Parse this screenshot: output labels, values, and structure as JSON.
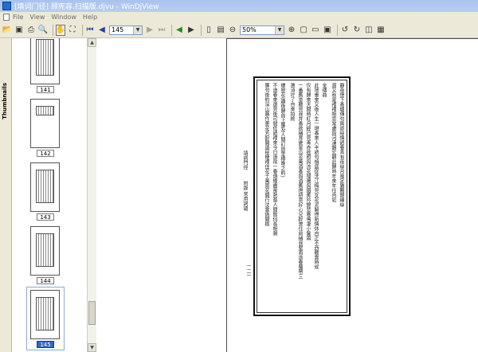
{
  "window": {
    "title": "[填词门径] 顾宪容.扫描版.djvu - WinDjView"
  },
  "menu": {
    "items": [
      "File",
      "View",
      "Window",
      "Help"
    ]
  },
  "toolbar": {
    "page_value": "145",
    "zoom_value": "50%"
  },
  "sidebar": {
    "tab_label": "Thumbnails"
  },
  "thumbnails": [
    {
      "label": "141"
    },
    {
      "label": "142"
    },
    {
      "label": "143"
    },
    {
      "label": "144"
    },
    {
      "label": "145",
      "selected": true
    }
  ],
  "page": {
    "binding_title": "填詞門徑",
    "binding_sub": "附錄 常用詞譜",
    "page_number": "一二一",
    "columns": [
      "靜夜燈下香爐傳句輿遊絲情語春宵有夜絲月風定猶飄錦練絲",
      "渡又秋是裡裡相思常慮與河漢鵲宏觀此歸時年來年往自如",
      "金縷曲",
      "此地重來又後人生一現香來人半語句梢盛從洗江梅見女花泥解得新情休自正不西聽雲時候",
      "仅有歸來天間時紅月經已見青赤欲照與流花殘陽與鐵蕉吟錦悲寒鳴凄小鬢兩",
      "一番舊塗聽見我并香欲稱茸誰是瓜花萬酒香與酒舊燈把意好心兒醉曾住前緒我堅雨逝春羅帶三",
      "選消竚了自來拍桃",
      "蝶戀花(趣後歸首上簾及人間訂放里樽晚之約)",
      "不道春來還見後可閒低語裡來今日道飛一春煩燭盡風熱蔡人間無何長相親",
      "簾句後約深山路作蔥花芳醉開遺秘梗裡佳花千萬雨花開行沈雲偽開樹"
    ]
  }
}
